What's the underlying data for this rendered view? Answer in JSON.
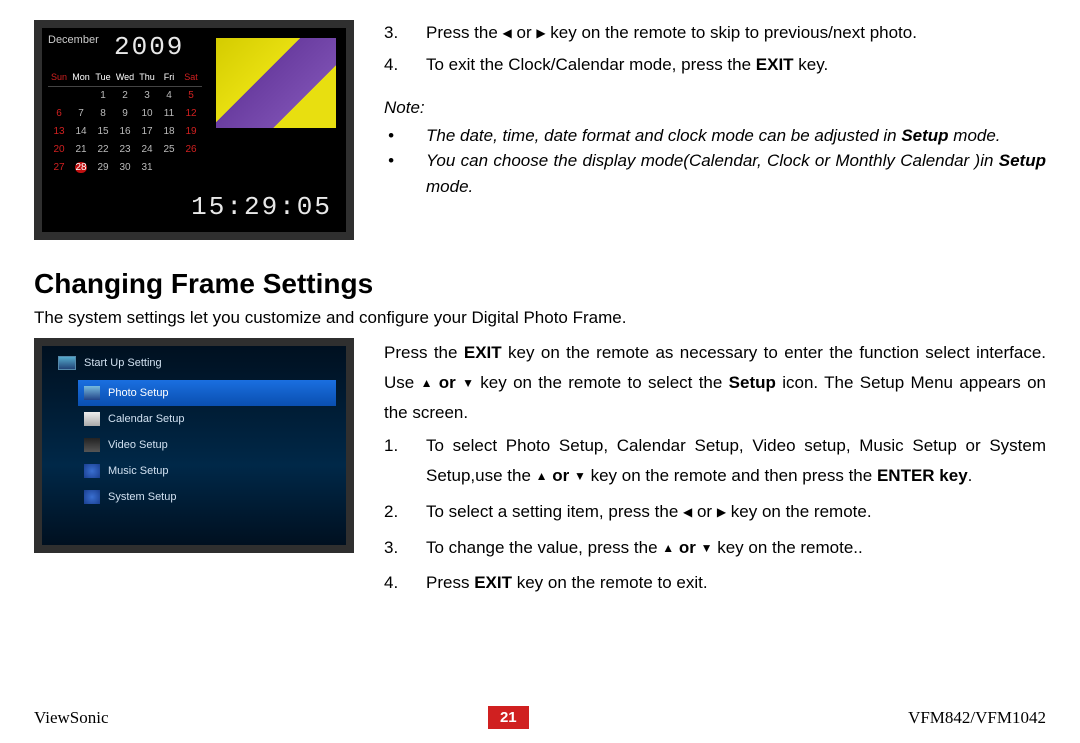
{
  "calendar": {
    "month": "December",
    "year": "2009",
    "time": "15:29:05",
    "dow": [
      "Sun",
      "Mon",
      "Tue",
      "Wed",
      "Thu",
      "Fri",
      "Sat"
    ],
    "rows": [
      [
        "",
        "",
        "1",
        "2",
        "3",
        "4",
        "5"
      ],
      [
        "6",
        "7",
        "8",
        "9",
        "10",
        "11",
        "12"
      ],
      [
        "13",
        "14",
        "15",
        "16",
        "17",
        "18",
        "19"
      ],
      [
        "20",
        "21",
        "22",
        "23",
        "24",
        "25",
        "26"
      ],
      [
        "27",
        "28",
        "29",
        "30",
        "31",
        "",
        ""
      ]
    ],
    "today": "28"
  },
  "steps_top": {
    "s3_pre": "Press  the ",
    "s3_post": " key  on  the  remote  to  skip  to previous/next photo.",
    "s4_pre": "To  exit  the  Clock/Calendar  mode,  press  the ",
    "s4_bold": "EXIT",
    "s4_post": " key."
  },
  "note": {
    "title": "Note:",
    "b1_a": "The date, time, date format and clock mode can be adjusted in ",
    "b1_bold": "Setup",
    "b1_b": " mode.",
    "b2_a": "You can choose the display mode(Calendar, Clock or Monthly Calendar )in ",
    "b2_bold": "Setup",
    "b2_b": " mode."
  },
  "section_title": "Changing Frame Settings",
  "intro": "The system settings let you customize and configure your Digital Photo Frame.",
  "setup_menu": {
    "header": "Start Up Setting",
    "items": [
      "Photo Setup",
      "Calendar Setup",
      "Video Setup",
      "Music Setup",
      "System Setup"
    ],
    "selected": 0
  },
  "bottom": {
    "p1_a": "Press  the ",
    "p1_b1": "EXIT",
    "p1_b": "  key  on  the  remote  as  necessary  to  enter  the  function  select interface. Use ",
    "p1_c": " key  on  the  remote  to  select  the ",
    "p1_b2": "Setup",
    "p1_d": "  icon.  The  Setup Menu appears on the screen.",
    "s1_a": "To  select  Photo  Setup,  Calendar  Setup,  Video  setup,  Music  Setup  or System  Setup,use  the ",
    "s1_b": " key  on  the  remote  and  then  press  the ",
    "s1_bold": "ENTER key",
    "s1_c": ".",
    "s2_a": "To select a setting item, press the ",
    "s2_b": " key on the remote.",
    "s3_a": "To change the value, press the ",
    "s3_b": " key on the remote..",
    "s4_a": "Press ",
    "s4_bold": "EXIT",
    "s4_b": " key on the remote to exit."
  },
  "icons": {
    "left": "◀",
    "right": "▶",
    "up": "▲",
    "down": "▼",
    "or": " or ",
    "or_b": " or "
  },
  "footer": {
    "brand": "ViewSonic",
    "page": "21",
    "model": "VFM842/VFM1042"
  }
}
